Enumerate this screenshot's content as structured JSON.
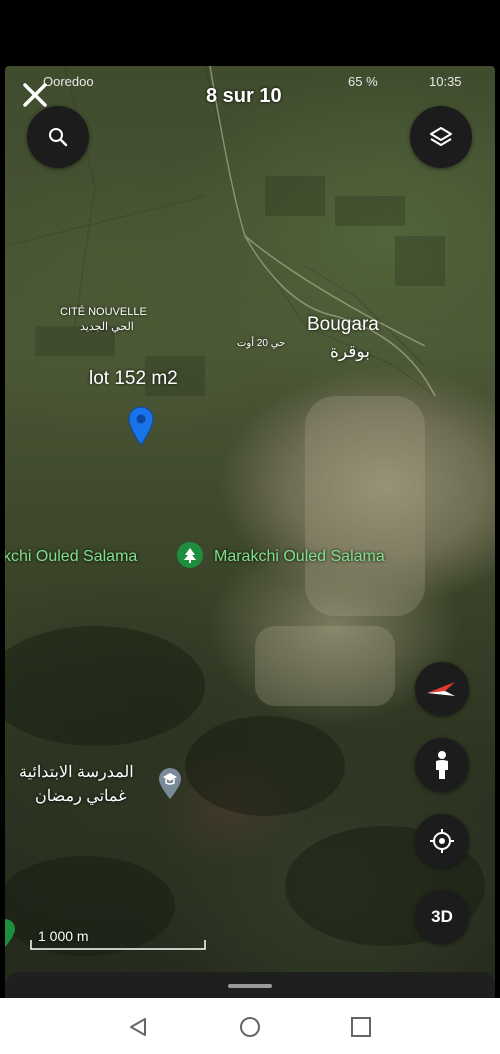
{
  "status_bar": {
    "carrier": "Ooredoo",
    "battery": "65 %",
    "time": "10:35"
  },
  "header": {
    "counter": "8 sur 10"
  },
  "buttons": {
    "close": "close-icon",
    "search": "search-icon",
    "layers": "layers-icon",
    "compass": "compass-icon",
    "street_view": "pegman-icon",
    "location": "my-location-icon",
    "three_d": "3D"
  },
  "map": {
    "pin_label": "lot 152 m2",
    "places": [
      {
        "id": "cite-nouvelle",
        "fr": "CITÉ NOUVELLE",
        "ar": "الحي الجديد"
      },
      {
        "id": "bougara",
        "fr": "Bougara",
        "ar": "بوقرة"
      },
      {
        "id": "bougara-small",
        "ar": "حي 20 أوت"
      },
      {
        "id": "marakchi-left",
        "fr": "kchi Ouled Salama"
      },
      {
        "id": "marakchi-right",
        "fr": "Marakchi Ouled Salama"
      },
      {
        "id": "school-line1",
        "ar": "المدرسة الابتدائية"
      },
      {
        "id": "school-line2",
        "ar": "غماتي رمضان"
      }
    ],
    "scale": "1 000 m"
  },
  "colors": {
    "pin": "#1a73e8",
    "park_label": "#7fe08a",
    "park_icon_bg": "#1e8e3e",
    "school_icon_bg": "#7a8a98"
  }
}
